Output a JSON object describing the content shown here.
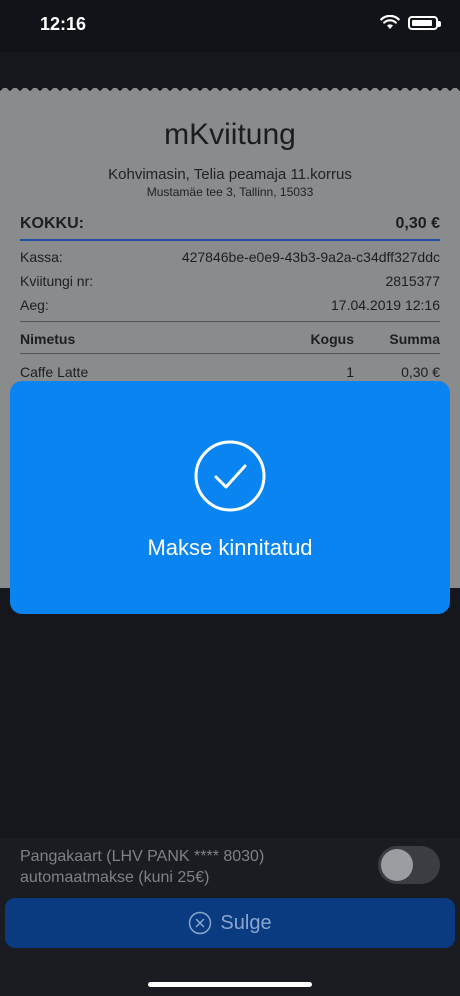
{
  "status_bar": {
    "time": "12:16"
  },
  "receipt": {
    "title": "mKviitung",
    "shop_name": "Kohvimasin, Telia peamaja 11.korrus",
    "address": "Mustamäe tee 3, Tallinn, 15033",
    "total_label": "KOKKU:",
    "total_value": "0,30 €",
    "fields": [
      {
        "label": "Kassa:",
        "value": "427846be-e0e9-43b3-9a2a-c34dff327ddc"
      },
      {
        "label": "Kviitungi nr:",
        "value": "2815377"
      },
      {
        "label": "Aeg:",
        "value": "17.04.2019 12:16"
      }
    ],
    "columns": {
      "name": "Nimetus",
      "qty": "Kogus",
      "sum": "Summa"
    },
    "items": [
      {
        "name": "Caffe Latte",
        "qty": "1",
        "sum": "0,30 €"
      }
    ]
  },
  "dialog": {
    "message": "Makse kinnitatud",
    "icon": "checkmark-circle-icon"
  },
  "autopay": {
    "line1": "Pangakaart (LHV PANK **** 8030)",
    "line2": "automaatmakse (kuni 25€)",
    "enabled": false
  },
  "close_button": {
    "label": "Sulge",
    "icon": "close-circle-icon"
  },
  "colors": {
    "accent": "#0a84f0",
    "button": "#0a3b80"
  }
}
